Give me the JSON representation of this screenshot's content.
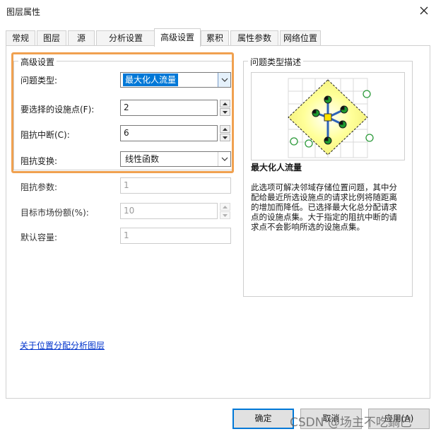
{
  "window": {
    "title": "图层属性",
    "close_label": "✕"
  },
  "tabs": [
    {
      "label": "常规",
      "active": false
    },
    {
      "label": "图层",
      "active": false
    },
    {
      "label": "源",
      "active": false
    },
    {
      "label": "分析设置",
      "active": false
    },
    {
      "label": "高级设置",
      "active": true
    },
    {
      "label": "累积",
      "active": false
    },
    {
      "label": "属性参数",
      "active": false
    },
    {
      "label": "网络位置",
      "active": false
    }
  ],
  "advanced": {
    "group_title": "高级设置",
    "problem_type": {
      "label": "问题类型:",
      "value": "最大化人流量"
    },
    "facilities": {
      "label": "要选择的设施点(F):",
      "value": "2"
    },
    "cutoff": {
      "label": "阻抗中断(C):",
      "value": "6"
    },
    "transform": {
      "label": "阻抗变换:",
      "value": "线性函数"
    },
    "param": {
      "label": "阻抗参数:",
      "value": "1"
    },
    "market_share": {
      "label": "目标市场份额(%):",
      "value": "10"
    },
    "capacity": {
      "label": "默认容量:",
      "value": "1"
    }
  },
  "description": {
    "group_title": "问题类型描述",
    "title": "最大化人流量",
    "text": "此选项可解决邻域存储位置问题，其中分配给最近所选设施点的请求比例将随距离的增加而降低。已选择最大化总分配请求点的设施点集。大于指定的阻抗中断的请求点不会影响所选的设施点集。"
  },
  "link_text": "关于位置分配分析图层",
  "buttons": {
    "ok": "确定",
    "cancel": "取消",
    "apply": "应用(A)"
  },
  "watermark": "CSDN @场主不吃鍋巴",
  "colors": {
    "highlight": "#f0a150",
    "accent": "#0078d7",
    "link": "#0033cc"
  }
}
